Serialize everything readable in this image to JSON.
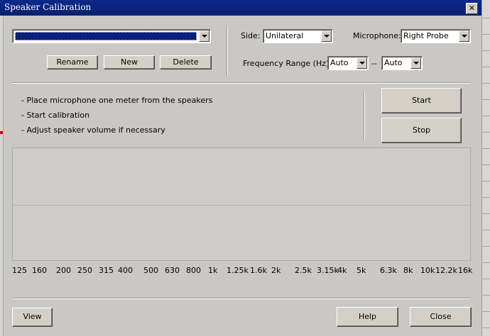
{
  "window": {
    "title": "Speaker Calibration",
    "close_symbol": "✕"
  },
  "profile": {
    "selected": ""
  },
  "buttons": {
    "rename": "Rename",
    "new": "New",
    "delete": "Delete",
    "start": "Start",
    "stop": "Stop",
    "view": "View",
    "help": "Help",
    "close": "Close"
  },
  "side": {
    "label": "Side:",
    "value": "Unilateral"
  },
  "microphone": {
    "label": "Microphone:",
    "value": "Right Probe"
  },
  "frequency_range": {
    "label": "Frequency Range (Hz):",
    "from": "Auto",
    "separator": "--",
    "to": "Auto"
  },
  "instructions": [
    "- Place microphone one meter from the speakers",
    "- Start calibration",
    "- Adjust speaker volume if necessary"
  ],
  "frequencies": [
    "125",
    "160",
    "200",
    "250",
    "315",
    "400",
    "500",
    "630",
    "800",
    "1k",
    "1.25k",
    "1.6k",
    "2k",
    "2.5k",
    "3.15k",
    "4k",
    "5k",
    "6.3k",
    "8k",
    "10k",
    "12.2k",
    "16k"
  ],
  "colors": {
    "titlebar": "#0b2a88",
    "selection": "#0a1e7c",
    "dialog": "#c9c8c5"
  }
}
